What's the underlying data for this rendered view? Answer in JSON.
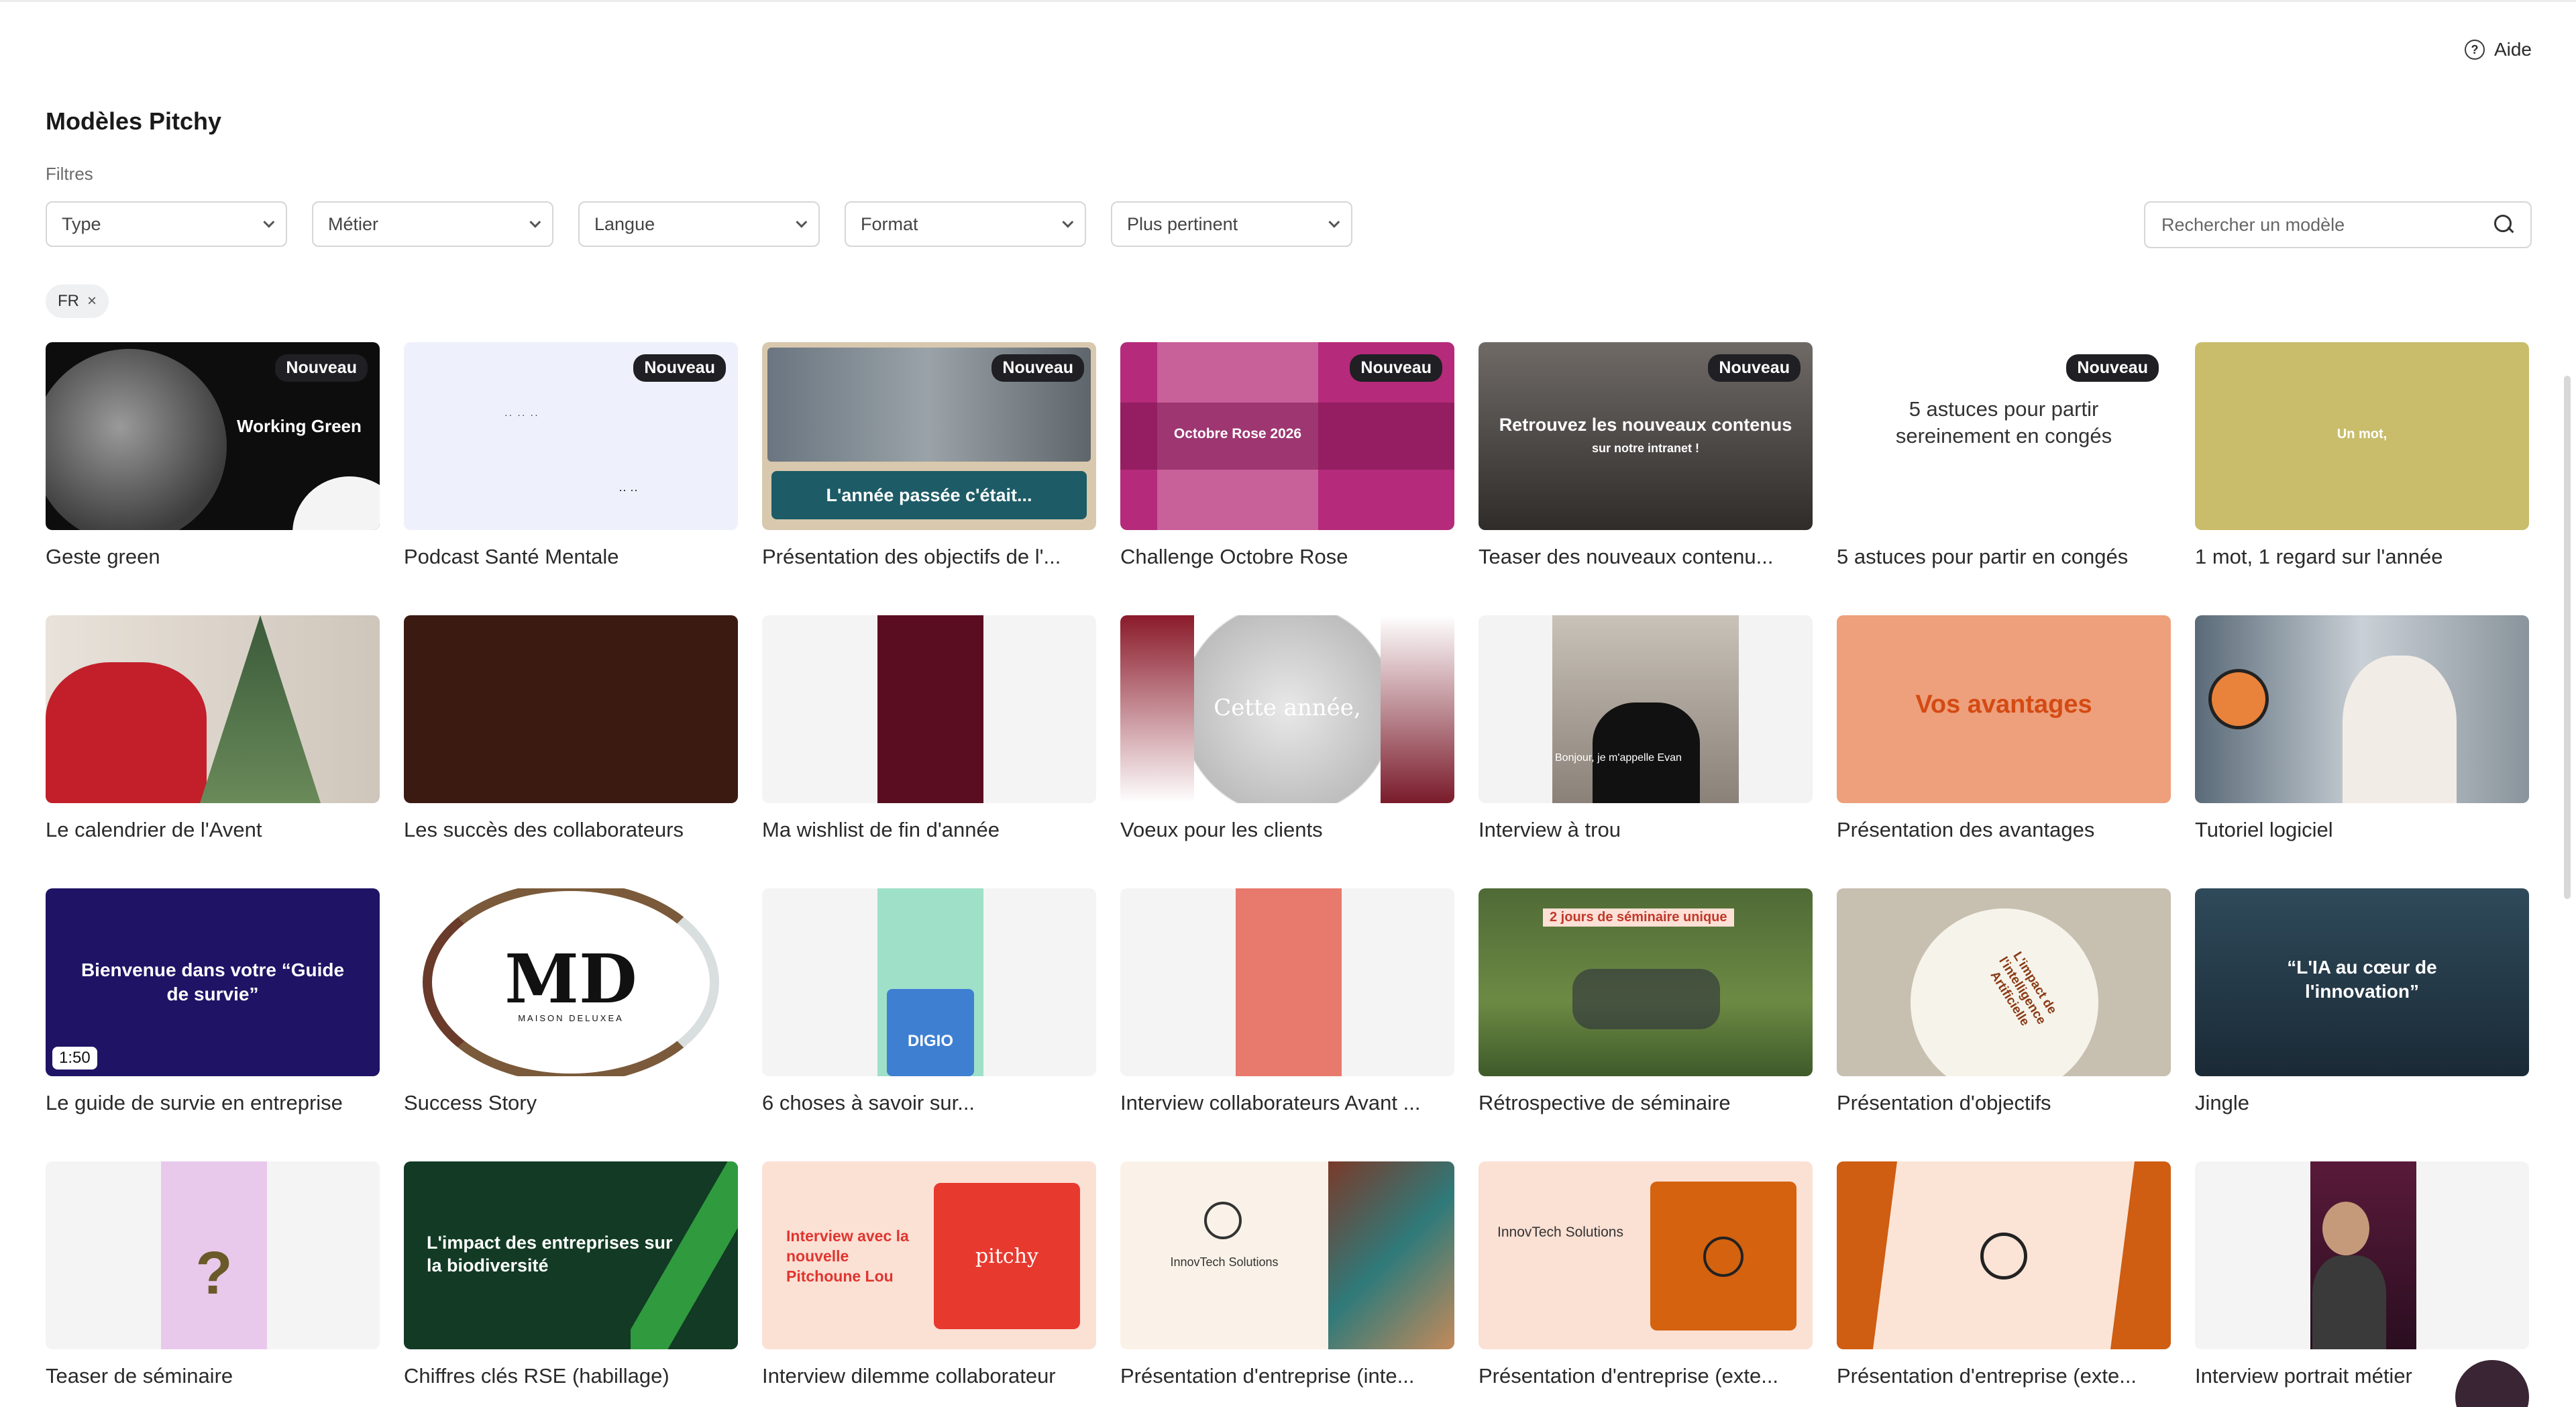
{
  "help": {
    "label": "Aide",
    "icon": "help-circle-icon"
  },
  "page": {
    "title": "Modèles Pitchy",
    "filters_label": "Filtres"
  },
  "filters": [
    {
      "label": "Type"
    },
    {
      "label": "Métier"
    },
    {
      "label": "Langue"
    },
    {
      "label": "Format"
    },
    {
      "label": "Plus pertinent"
    }
  ],
  "search": {
    "placeholder": "Rechercher un modèle",
    "icon": "search-icon"
  },
  "active_filters": [
    {
      "label": "FR",
      "remove": "×"
    }
  ],
  "badge_text": "Nouveau",
  "templates": [
    {
      "label": "Geste green",
      "badge": true,
      "thumb_text": "Working Green"
    },
    {
      "label": "Podcast Santé Mentale",
      "badge": true
    },
    {
      "label": "Présentation des objectifs de l'...",
      "badge": true,
      "thumb_text": "L'année passée c'était..."
    },
    {
      "label": "Challenge Octobre Rose",
      "badge": true,
      "thumb_text": "Octobre Rose 2026"
    },
    {
      "label": "Teaser des nouveaux contenu...",
      "badge": true,
      "thumb_text": "Retrouvez les nouveaux contenus",
      "thumb_sub": "sur notre intranet !"
    },
    {
      "label": "5 astuces pour partir en congés",
      "badge": true,
      "thumb_text": "5 astuces pour partir sereinement en congés"
    },
    {
      "label": "1 mot, 1 regard sur l'année",
      "thumb_text": "Un mot,"
    },
    {
      "label": "Le calendrier de l'Avent"
    },
    {
      "label": "Les succès des collaborateurs"
    },
    {
      "label": "Ma wishlist de fin d'année"
    },
    {
      "label": "Voeux pour les clients",
      "thumb_text": "Cette année,"
    },
    {
      "label": "Interview à trou",
      "thumb_text": "Bonjour, je m'appelle Evan"
    },
    {
      "label": "Présentation des avantages",
      "thumb_text": "Vos avantages"
    },
    {
      "label": "Tutoriel logiciel"
    },
    {
      "label": "Le guide de survie en entreprise",
      "thumb_text": "Bienvenue dans votre “Guide de survie”",
      "duration": "1:50"
    },
    {
      "label": "Success Story",
      "thumb_text": "MD",
      "thumb_sub": "MAISON DELUXEA"
    },
    {
      "label": "6 choses à savoir sur...",
      "thumb_text": "DIGIO"
    },
    {
      "label": "Interview collaborateurs Avant ..."
    },
    {
      "label": "Rétrospective de séminaire",
      "thumb_text": "2 jours de séminaire unique"
    },
    {
      "label": "Présentation d'objectifs",
      "thumb_text": "L'impact de l'intelligence Artificielle"
    },
    {
      "label": "Jingle",
      "thumb_text": "“L'IA au cœur de l'innovation”"
    },
    {
      "label": "Teaser de séminaire"
    },
    {
      "label": "Chiffres clés RSE (habillage)",
      "thumb_text": "L'impact des entreprises sur la biodiversité"
    },
    {
      "label": "Interview dilemme collaborateur",
      "thumb_text": "Interview avec la nouvelle Pitchoune Lou",
      "thumb_sub": "pitchy"
    },
    {
      "label": "Présentation d'entreprise (inte...",
      "thumb_text": "InnovTech Solutions"
    },
    {
      "label": "Présentation d'entreprise (exte...",
      "thumb_text": "InnovTech Solutions"
    },
    {
      "label": "Présentation d'entreprise (exte..."
    },
    {
      "label": "Interview portrait métier"
    }
  ],
  "colors": {
    "accent_dark": "#1f1f24",
    "chip_bg": "#eef0f2",
    "border": "#d6d6d6"
  }
}
